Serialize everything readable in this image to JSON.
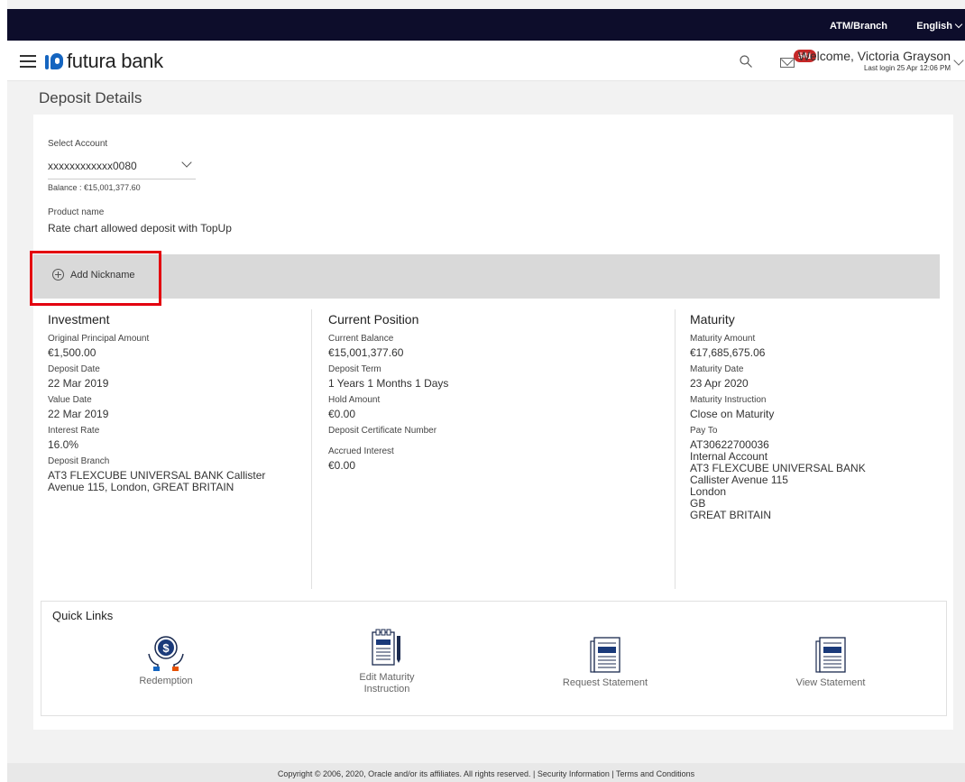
{
  "topbar": {
    "atm_branch": "ATM/Branch",
    "language": "English"
  },
  "header": {
    "brand": "futura bank",
    "notification_count": "541",
    "welcome": "Welcome, Victoria Grayson",
    "last_login": "Last login 25 Apr 12:06 PM"
  },
  "page": {
    "title": "Deposit Details"
  },
  "account": {
    "select_label": "Select Account",
    "selected": "xxxxxxxxxxxx0080",
    "balance": "Balance : €15,001,377.60",
    "product_label": "Product name",
    "product_value": "Rate chart allowed deposit with TopUp",
    "add_nickname": "Add Nickname"
  },
  "investment": {
    "heading": "Investment",
    "original_principal_label": "Original Principal Amount",
    "original_principal": "€1,500.00",
    "deposit_date_label": "Deposit Date",
    "deposit_date": "22 Mar 2019",
    "value_date_label": "Value Date",
    "value_date": "22 Mar 2019",
    "interest_rate_label": "Interest Rate",
    "interest_rate": "16.0%",
    "deposit_branch_label": "Deposit Branch",
    "deposit_branch_line1": "AT3 FLEXCUBE UNIVERSAL BANK Callister",
    "deposit_branch_line2": "Avenue 115, London, GREAT BRITAIN"
  },
  "current_position": {
    "heading": "Current Position",
    "current_balance_label": "Current Balance",
    "current_balance": "€15,001,377.60",
    "deposit_term_label": "Deposit Term",
    "deposit_term": "1 Years 1 Months 1 Days",
    "hold_amount_label": "Hold Amount",
    "hold_amount": "€0.00",
    "certificate_label": "Deposit Certificate Number",
    "accrued_interest_label": "Accrued Interest",
    "accrued_interest": "€0.00"
  },
  "maturity": {
    "heading": "Maturity",
    "maturity_amount_label": "Maturity Amount",
    "maturity_amount": "€17,685,675.06",
    "maturity_date_label": "Maturity Date",
    "maturity_date": "23 Apr 2020",
    "instruction_label": "Maturity Instruction",
    "instruction": "Close on Maturity",
    "pay_to_label": "Pay To",
    "pay_to_lines": [
      "AT30622700036",
      "Internal Account",
      "AT3 FLEXCUBE UNIVERSAL BANK",
      "Callister Avenue 115",
      "London",
      "GB",
      "GREAT BRITAIN"
    ]
  },
  "quick_links": {
    "heading": "Quick Links",
    "items": [
      {
        "label": "Redemption",
        "icon": "redemption-icon"
      },
      {
        "label_line1": "Edit Maturity",
        "label_line2": "Instruction",
        "icon": "edit-maturity-icon"
      },
      {
        "label": "Request Statement",
        "icon": "request-statement-icon"
      },
      {
        "label": "View Statement",
        "icon": "view-statement-icon"
      }
    ]
  },
  "footer": {
    "text": "Copyright © 2006, 2020, Oracle and/or its affiliates. All rights reserved. | Security Information | Terms and Conditions"
  },
  "colors": {
    "topbar": "#0d0d2b",
    "brand_blue": "#1565c0",
    "badge": "#c62828",
    "highlight": "#e3000f",
    "nickname_bar": "#d9d9d9"
  }
}
